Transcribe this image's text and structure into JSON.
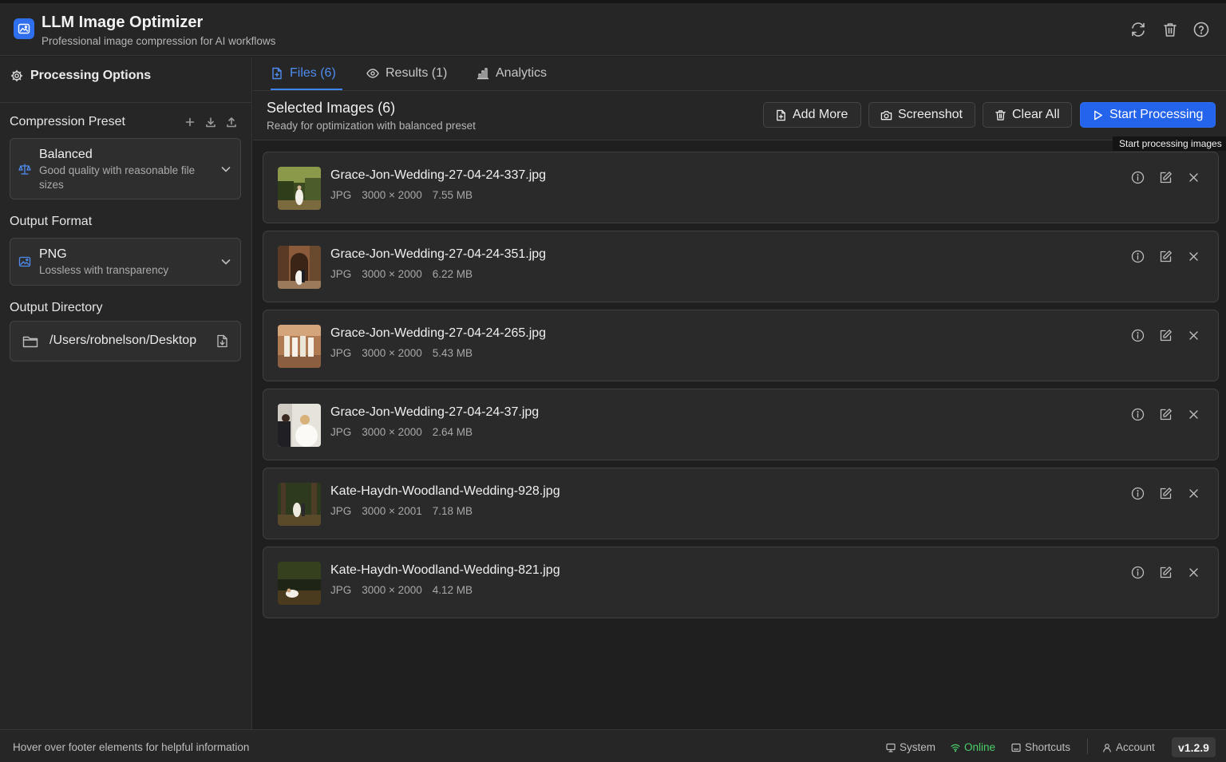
{
  "app": {
    "title": "LLM Image Optimizer",
    "subtitle": "Professional image compression for AI workflows"
  },
  "header_actions": [
    "refresh-icon",
    "trash-icon",
    "help-icon"
  ],
  "sidebar": {
    "heading": "Processing Options",
    "compression": {
      "label": "Compression Preset",
      "selected_title": "Balanced",
      "selected_desc": "Good quality with reasonable file sizes",
      "icon": "balance-scale-icon"
    },
    "format": {
      "label": "Output Format",
      "selected_title": "PNG",
      "selected_desc": "Lossless with transparency",
      "icon": "image-icon"
    },
    "directory": {
      "label": "Output Directory",
      "path": "/Users/robnelson/Desktop"
    }
  },
  "tabs": [
    {
      "label": "Files (6)",
      "icon": "file-icon",
      "active": true
    },
    {
      "label": "Results (1)",
      "icon": "eye-icon",
      "active": false
    },
    {
      "label": "Analytics",
      "icon": "bar-chart-icon",
      "active": false
    }
  ],
  "toolbar": {
    "title": "Selected Images (6)",
    "subtitle": "Ready for optimization with balanced preset",
    "add_more": "Add More",
    "screenshot": "Screenshot",
    "clear_all": "Clear All",
    "start": "Start Processing",
    "tooltip": "Start processing images"
  },
  "files": [
    {
      "name": "Grace-Jon-Wedding-27-04-24-337.jpg",
      "type": "JPG",
      "dims": "3000 × 2000",
      "size": "7.55 MB"
    },
    {
      "name": "Grace-Jon-Wedding-27-04-24-351.jpg",
      "type": "JPG",
      "dims": "3000 × 2000",
      "size": "6.22 MB"
    },
    {
      "name": "Grace-Jon-Wedding-27-04-24-265.jpg",
      "type": "JPG",
      "dims": "3000 × 2000",
      "size": "5.43 MB"
    },
    {
      "name": "Grace-Jon-Wedding-27-04-24-37.jpg",
      "type": "JPG",
      "dims": "3000 × 2000",
      "size": "2.64 MB"
    },
    {
      "name": "Kate-Haydn-Woodland-Wedding-928.jpg",
      "type": "JPG",
      "dims": "3000 × 2001",
      "size": "7.18 MB"
    },
    {
      "name": "Kate-Haydn-Woodland-Wedding-821.jpg",
      "type": "JPG",
      "dims": "3000 × 2000",
      "size": "4.12 MB"
    }
  ],
  "footer": {
    "hint": "Hover over footer elements for helpful information",
    "system": "System",
    "status": "Online",
    "shortcuts": "Shortcuts",
    "account": "Account",
    "version": "v1.2.9"
  },
  "colors": {
    "accent": "#2463eb",
    "online": "#4ccf6a",
    "background": "#1f1f1f",
    "panel": "#262626"
  }
}
